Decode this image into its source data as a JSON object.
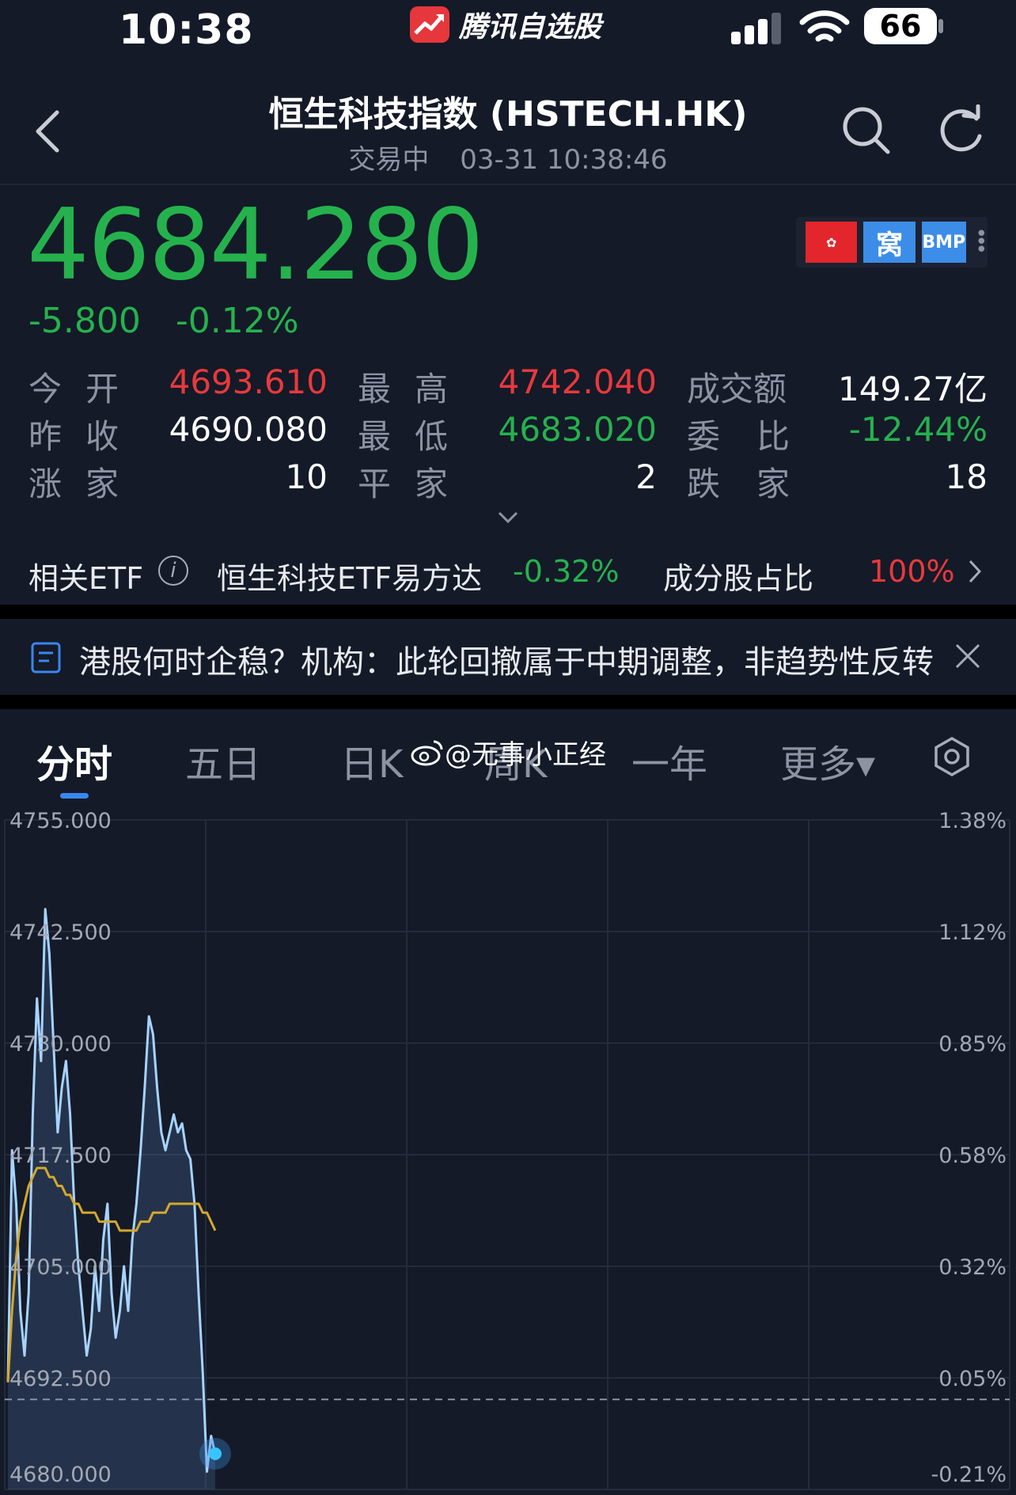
{
  "status_bar": {
    "time": "10:38",
    "app_name": "腾讯自选股",
    "battery": "66"
  },
  "header": {
    "title": "恒生科技指数 (HSTECH.HK)",
    "status": "交易中",
    "datetime": "03-31 10:38:46"
  },
  "quote": {
    "price": "4684.280",
    "change": "-5.800",
    "change_pct": "-0.12%",
    "badges": {
      "hk": "✿",
      "wo": "窝",
      "bmp": "BMP"
    }
  },
  "stats": {
    "open_label": "今开",
    "open": "4693.610",
    "high_label": "最高",
    "high": "4742.040",
    "turnover_label": "成交额",
    "turnover": "149.27亿",
    "prev_close_label": "昨收",
    "prev_close": "4690.080",
    "low_label": "最低",
    "low": "4683.020",
    "ratio_label": "委比",
    "ratio": "-12.44%",
    "up_label": "涨家",
    "up": "10",
    "flat_label": "平家",
    "flat": "2",
    "down_label": "跌家",
    "down": "18"
  },
  "etf": {
    "label": "相关ETF",
    "name": "恒生科技ETF易方达",
    "pct": "-0.32%",
    "component_label": "成分股占比",
    "component_value": "100%"
  },
  "news": {
    "headline": "港股何时企稳？机构：此轮回撤属于中期调整，非趋势性反转"
  },
  "tabs": [
    {
      "label": "分时"
    },
    {
      "label": "五日"
    },
    {
      "label": "日K"
    },
    {
      "label": "周K"
    },
    {
      "label": "一年"
    },
    {
      "label": "更多▾"
    }
  ],
  "watermark": "@无事小正经",
  "chart_data": {
    "type": "line",
    "y_left_ticks": [
      "4755.000",
      "4742.500",
      "4730.000",
      "4717.500",
      "4705.000",
      "4692.500",
      "4680.000"
    ],
    "y_right_ticks": [
      "1.38%",
      "1.12%",
      "0.85%",
      "0.58%",
      "0.32%",
      "0.05%",
      "-0.21%"
    ],
    "ylim": [
      4680,
      4755
    ],
    "prev_close": 4690.08,
    "series": [
      {
        "values": [
          4692,
          4718,
          4712,
          4700,
          4695,
          4702,
          4722,
          4735,
          4728,
          4745,
          4740,
          4730,
          4720,
          4725,
          4728,
          4722,
          4712,
          4705,
          4700,
          4695,
          4698,
          4705,
          4700,
          4708,
          4712,
          4702,
          4697,
          4700,
          4705,
          4700,
          4708,
          4712,
          4718,
          4725,
          4733,
          4731,
          4725,
          4720,
          4718,
          4720,
          4722,
          4720,
          4721,
          4718,
          4717,
          4712,
          4702,
          4693,
          4682,
          4686,
          4684
        ]
      },
      {
        "values": [
          4692,
          4700,
          4706,
          4710,
          4712,
          4714,
          4715,
          4716,
          4716,
          4716,
          4715,
          4715,
          4714,
          4714,
          4713,
          4713,
          4712,
          4712,
          4711,
          4711,
          4711,
          4711,
          4710,
          4710,
          4710,
          4710,
          4710,
          4709,
          4709,
          4709,
          4709,
          4709,
          4710,
          4710,
          4710,
          4711,
          4711,
          4711,
          4711,
          4712,
          4712,
          4712,
          4712,
          4712,
          4712,
          4712,
          4712,
          4711,
          4711,
          4710,
          4709
        ]
      }
    ]
  }
}
